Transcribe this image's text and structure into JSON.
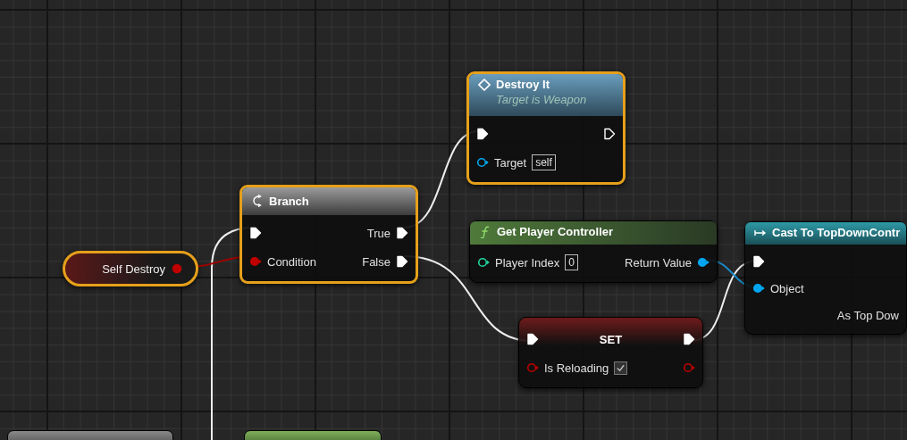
{
  "nodes": [
    {
      "kind": "variable",
      "title": "Self Destroy",
      "selected": true,
      "rows": [
        {
          "out": {
            "kind": "bool",
            "connected": true
          }
        }
      ]
    },
    {
      "kind": "branch",
      "title": "Branch",
      "selected": true,
      "rows": [
        {
          "in": {
            "kind": "exec",
            "connected": true
          },
          "out": {
            "kind": "exec",
            "label": "True",
            "connected": true
          }
        },
        {
          "in": {
            "kind": "bool",
            "label": "Condition",
            "connected": true
          },
          "out": {
            "kind": "exec",
            "label": "False",
            "connected": true
          }
        }
      ]
    },
    {
      "kind": "function",
      "title": "Destroy It",
      "subtitle": "Target is Weapon",
      "selected": true,
      "rows": [
        {
          "in": {
            "kind": "exec",
            "connected": true
          },
          "out": {
            "kind": "exec",
            "connected": false
          }
        },
        {
          "in": {
            "kind": "object",
            "label": "Target",
            "value": "self",
            "connected": false
          }
        }
      ]
    },
    {
      "kind": "pure",
      "title": "Get Player Controller",
      "selected": false,
      "rows": [
        {
          "in": {
            "kind": "int",
            "label": "Player Index",
            "value": "0",
            "connected": false
          },
          "out": {
            "kind": "object",
            "label": "Return Value",
            "connected": true
          }
        }
      ]
    },
    {
      "kind": "cast",
      "title": "Cast To TopDownContr",
      "selected": false,
      "rows": [
        {
          "in": {
            "kind": "exec",
            "connected": true
          }
        },
        {
          "in": {
            "kind": "object",
            "label": "Object",
            "connected": true
          }
        },
        {
          "out": {
            "label": "As Top Dow"
          }
        }
      ]
    },
    {
      "kind": "set",
      "title": "SET",
      "selected": false,
      "rows": [
        {
          "in": {
            "kind": "exec",
            "connected": true
          },
          "out": {
            "kind": "exec",
            "connected": true
          }
        },
        {
          "in": {
            "kind": "bool",
            "label": "Is Reloading",
            "checked": true,
            "connected": false
          },
          "out": {
            "kind": "bool",
            "connected": false
          }
        }
      ]
    }
  ]
}
